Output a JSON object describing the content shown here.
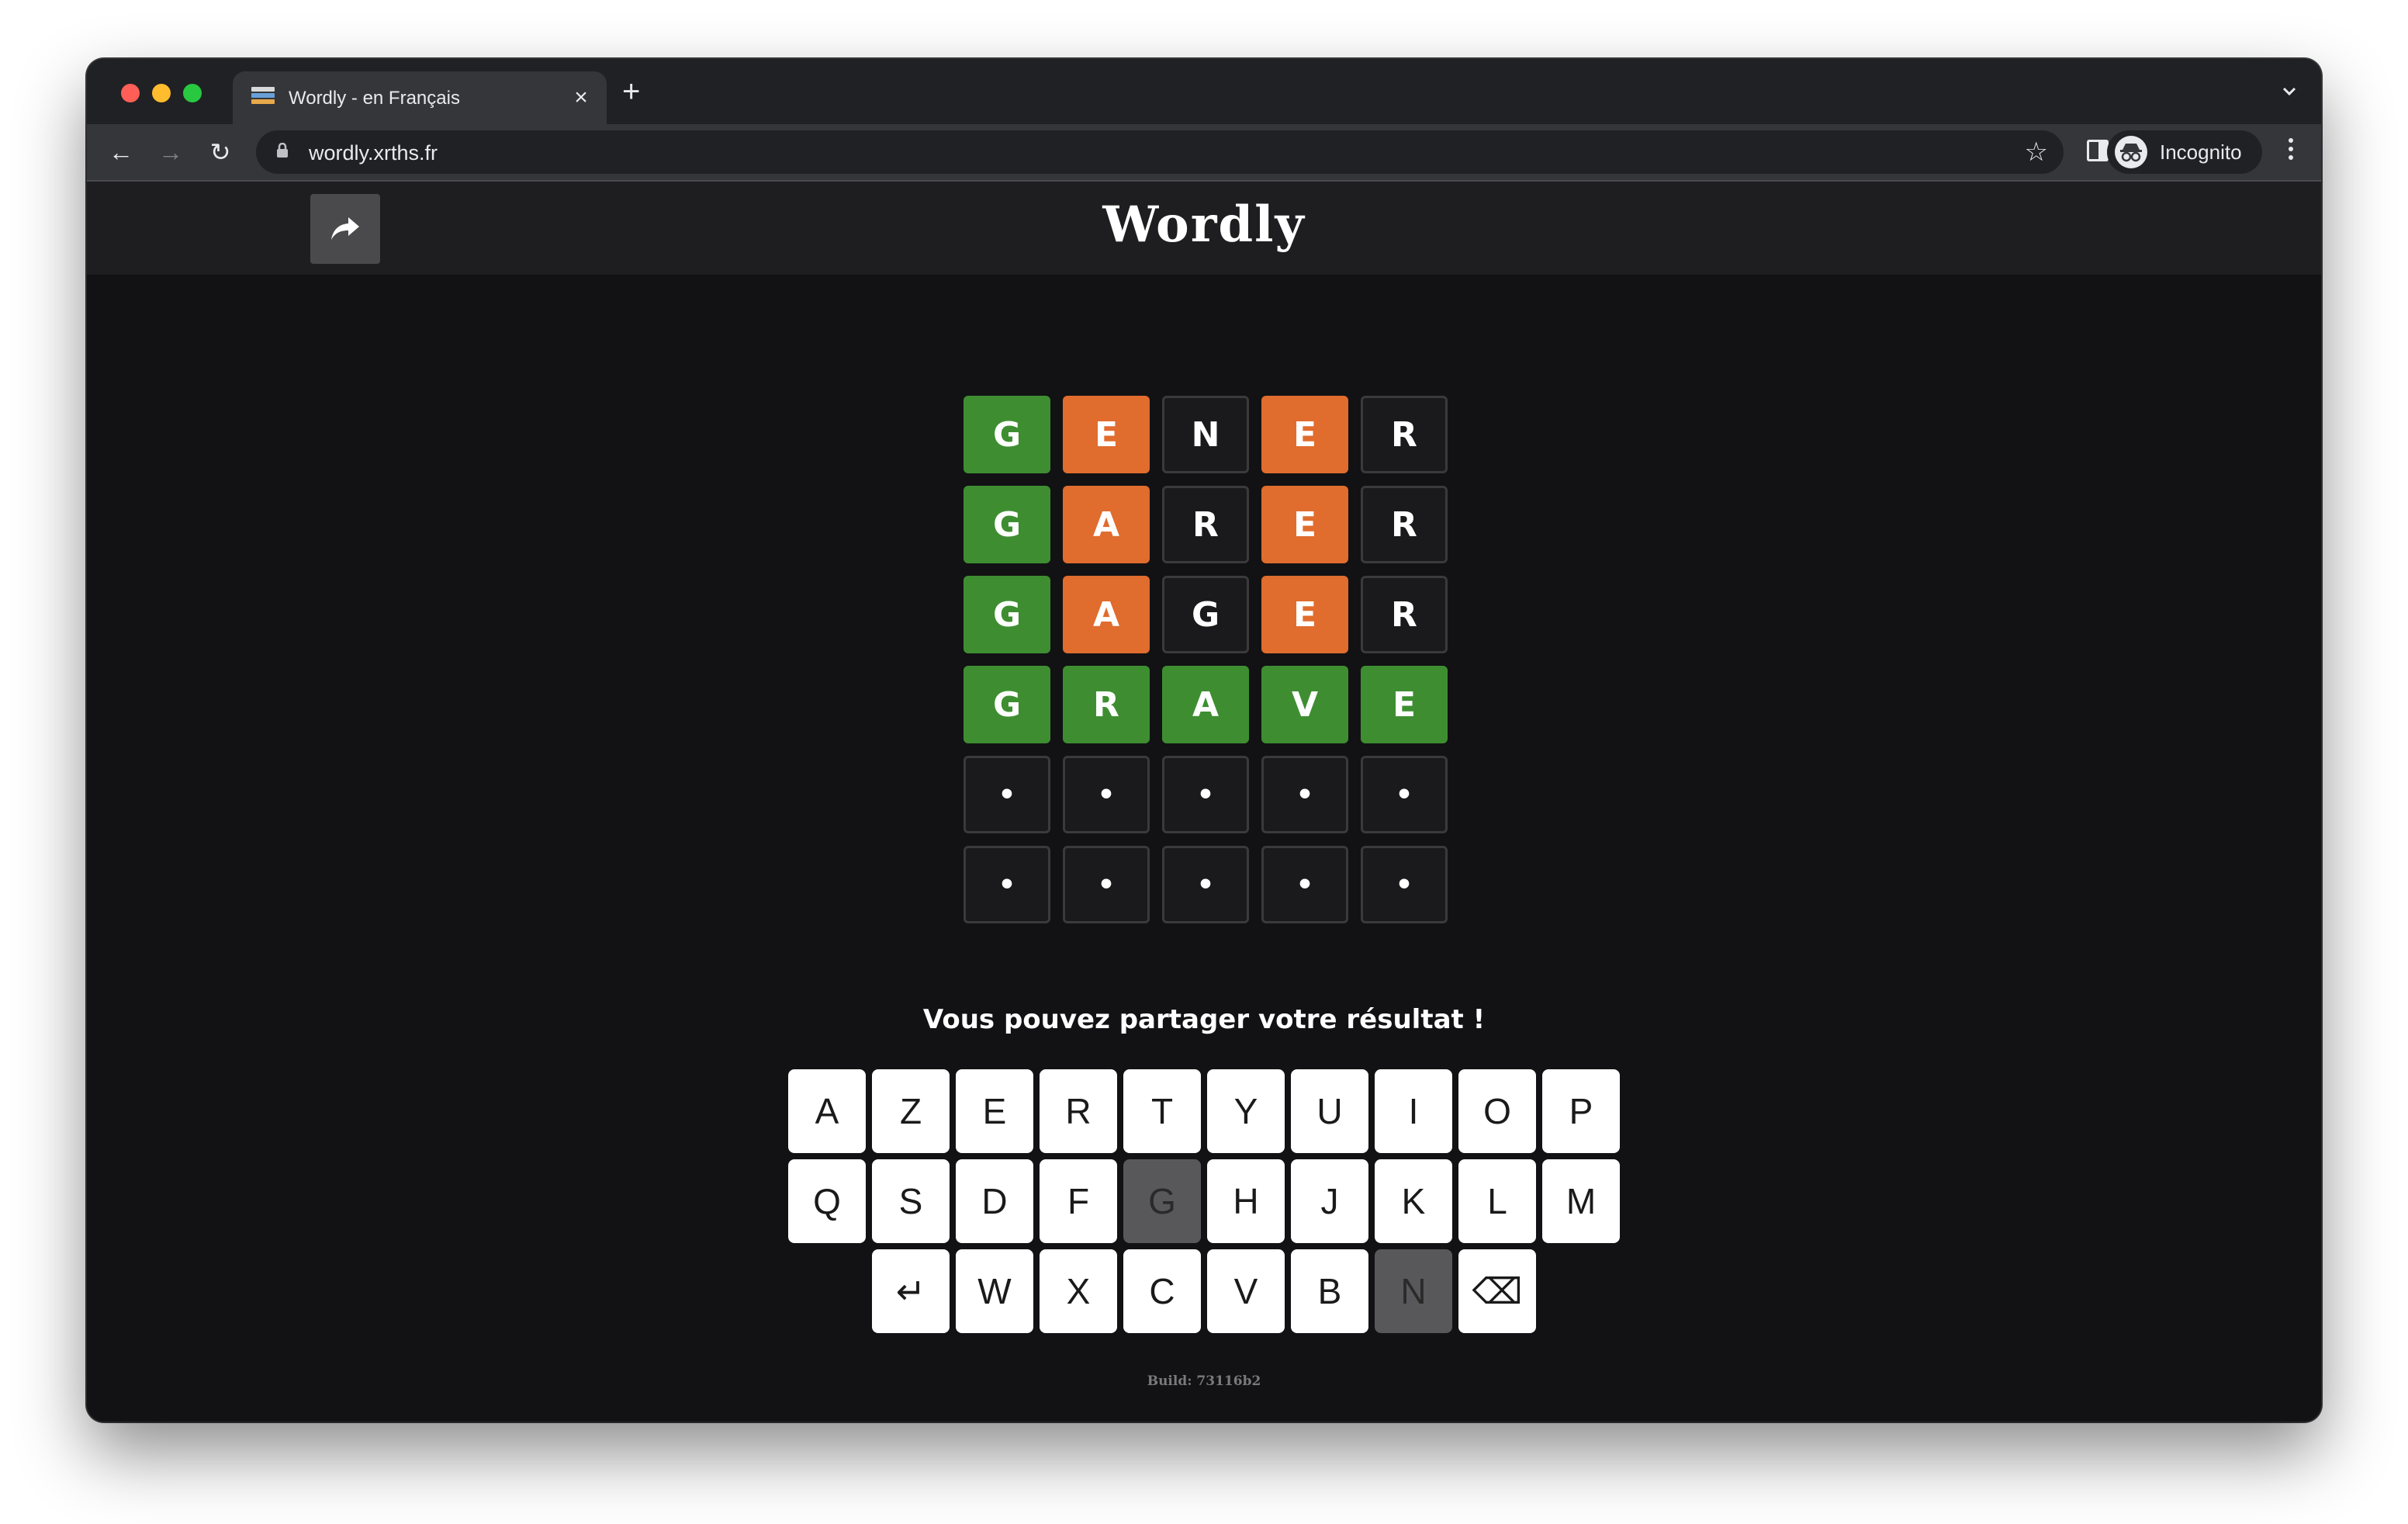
{
  "browser": {
    "tab_title": "Wordly - en Français",
    "tab_close": "×",
    "new_tab": "+",
    "url": "wordly.xrths.fr",
    "profile_label": "Incognito",
    "back": "←",
    "forward": "→",
    "reload": "↻",
    "bookmark": "☆"
  },
  "header": {
    "logo": "Wordly",
    "share_icon": "share-arrow-icon"
  },
  "board": {
    "rows": [
      [
        {
          "letter": "G",
          "state": "green"
        },
        {
          "letter": "E",
          "state": "orange"
        },
        {
          "letter": "N",
          "state": "absent"
        },
        {
          "letter": "E",
          "state": "orange"
        },
        {
          "letter": "R",
          "state": "absent"
        }
      ],
      [
        {
          "letter": "G",
          "state": "green"
        },
        {
          "letter": "A",
          "state": "orange"
        },
        {
          "letter": "R",
          "state": "absent"
        },
        {
          "letter": "E",
          "state": "orange"
        },
        {
          "letter": "R",
          "state": "absent"
        }
      ],
      [
        {
          "letter": "G",
          "state": "green"
        },
        {
          "letter": "A",
          "state": "orange"
        },
        {
          "letter": "G",
          "state": "absent"
        },
        {
          "letter": "E",
          "state": "orange"
        },
        {
          "letter": "R",
          "state": "absent"
        }
      ],
      [
        {
          "letter": "G",
          "state": "green"
        },
        {
          "letter": "R",
          "state": "green"
        },
        {
          "letter": "A",
          "state": "green"
        },
        {
          "letter": "V",
          "state": "green"
        },
        {
          "letter": "E",
          "state": "green"
        }
      ],
      [
        {
          "letter": "•",
          "state": "empty"
        },
        {
          "letter": "•",
          "state": "empty"
        },
        {
          "letter": "•",
          "state": "empty"
        },
        {
          "letter": "•",
          "state": "empty"
        },
        {
          "letter": "•",
          "state": "empty"
        }
      ],
      [
        {
          "letter": "•",
          "state": "empty"
        },
        {
          "letter": "•",
          "state": "empty"
        },
        {
          "letter": "•",
          "state": "empty"
        },
        {
          "letter": "•",
          "state": "empty"
        },
        {
          "letter": "•",
          "state": "empty"
        }
      ]
    ]
  },
  "message": "Vous pouvez partager votre résultat !",
  "keyboard": {
    "rows": [
      [
        {
          "label": "A"
        },
        {
          "label": "Z"
        },
        {
          "label": "E"
        },
        {
          "label": "R"
        },
        {
          "label": "T"
        },
        {
          "label": "Y"
        },
        {
          "label": "U"
        },
        {
          "label": "I"
        },
        {
          "label": "O"
        },
        {
          "label": "P"
        }
      ],
      [
        {
          "label": "Q"
        },
        {
          "label": "S"
        },
        {
          "label": "D"
        },
        {
          "label": "F"
        },
        {
          "label": "G",
          "state": "used"
        },
        {
          "label": "H"
        },
        {
          "label": "J"
        },
        {
          "label": "K"
        },
        {
          "label": "L"
        },
        {
          "label": "M"
        }
      ],
      [
        {
          "label": "↵",
          "name": "enter-key"
        },
        {
          "label": "W"
        },
        {
          "label": "X"
        },
        {
          "label": "C"
        },
        {
          "label": "V"
        },
        {
          "label": "B"
        },
        {
          "label": "N",
          "state": "used"
        },
        {
          "label": "⌫",
          "name": "backspace-key"
        }
      ]
    ]
  },
  "footer": {
    "build": "Build: 73116b2"
  },
  "colors": {
    "correct": "#3e8e31",
    "present": "#e06c2e",
    "used_key": "#58585a"
  }
}
